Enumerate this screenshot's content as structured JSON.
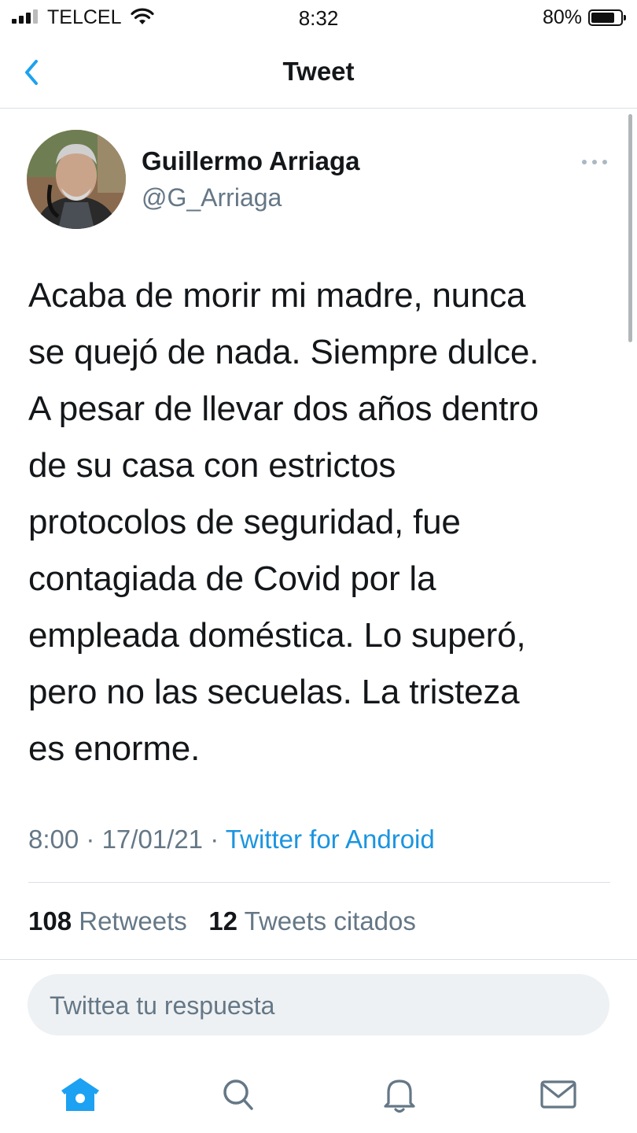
{
  "status_bar": {
    "carrier": "TELCEL",
    "time": "8:32",
    "battery_percent": "80%",
    "battery_level": 0.8
  },
  "header": {
    "title": "Tweet",
    "back_icon": "chevron-left-icon"
  },
  "tweet": {
    "author_name": "Guillermo Arriaga",
    "author_handle": "@G_Arriaga",
    "text_lines": [
      "Acaba de morir mi madre, nunca",
      "se quejó de nada.  Siempre dulce.",
      "A pesar de llevar dos años dentro",
      "de su casa con estrictos",
      "protocolos de seguridad, fue",
      "contagiada de Covid por la",
      "empleada doméstica. Lo superó,",
      "pero no las secuelas. La tristeza",
      "es enorme."
    ],
    "time": "8:00",
    "date": "17/01/21",
    "separator": "·",
    "source": "Twitter for Android",
    "retweets_count": "108",
    "retweets_label": "Retweets",
    "quotes_count": "12",
    "quotes_label": "Tweets citados"
  },
  "reply": {
    "placeholder": "Twittea tu respuesta"
  },
  "tabbar": {
    "items": [
      "home-icon",
      "search-icon",
      "notifications-bell-icon",
      "messages-envelope-icon"
    ]
  },
  "colors": {
    "accent": "#1da1f2",
    "link": "#1b95e0",
    "secondary_text": "#657786",
    "primary_text": "#14171a",
    "divider": "#dcdfe2",
    "reply_bg": "#eef1f3"
  }
}
